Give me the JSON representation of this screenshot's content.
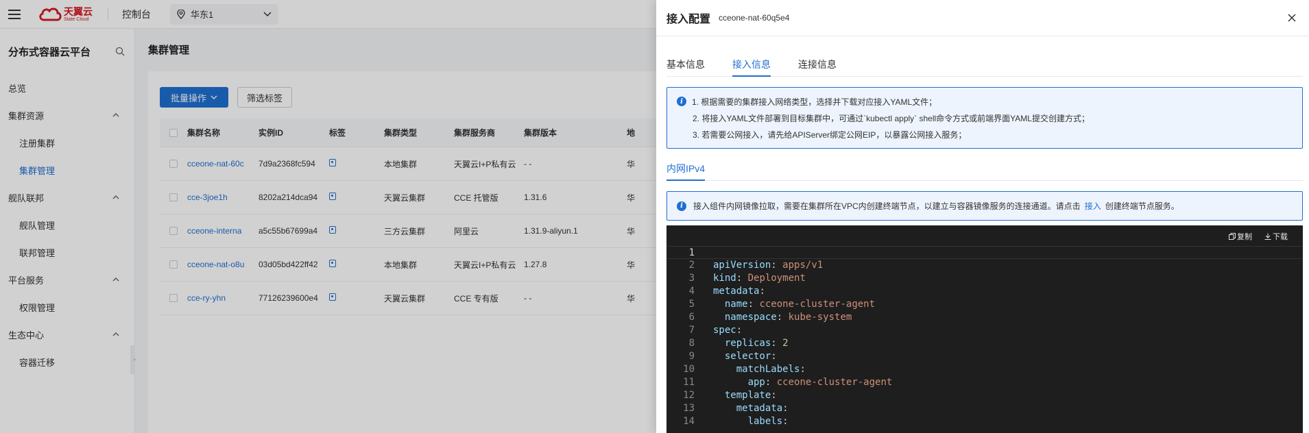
{
  "topbar": {
    "logo_cn": "天翼云",
    "logo_en": "State Cloud",
    "console": "控制台",
    "region": "华东1"
  },
  "sidebar": {
    "title": "分布式容器云平台",
    "items": [
      {
        "label": "总览",
        "type": "item"
      },
      {
        "label": "集群资源",
        "type": "group"
      },
      {
        "label": "注册集群",
        "type": "sub"
      },
      {
        "label": "集群管理",
        "type": "sub",
        "active": true
      },
      {
        "label": "舰队联邦",
        "type": "group"
      },
      {
        "label": "舰队管理",
        "type": "sub"
      },
      {
        "label": "联邦管理",
        "type": "sub"
      },
      {
        "label": "平台服务",
        "type": "group"
      },
      {
        "label": "权限管理",
        "type": "sub"
      },
      {
        "label": "生态中心",
        "type": "group"
      },
      {
        "label": "容器迁移",
        "type": "sub"
      }
    ]
  },
  "main": {
    "title": "集群管理",
    "batch_button": "批量操作",
    "filter_button": "筛选标签",
    "columns": [
      "集群名称",
      "实例ID",
      "标签",
      "集群类型",
      "集群服务商",
      "集群版本",
      "地"
    ],
    "rows": [
      {
        "name": "cceone-nat-60c",
        "id": "7d9a2368fc594",
        "type": "本地集群",
        "provider": "天翼云I+P私有云",
        "version": "- -",
        "region": "华"
      },
      {
        "name": "cce-3joe1h",
        "id": "8202a214dca94",
        "type": "天翼云集群",
        "provider": "CCE 托管版",
        "version": "1.31.6",
        "region": "华"
      },
      {
        "name": "cceone-interna",
        "id": "a5c55b67699a4",
        "type": "三方云集群",
        "provider": "阿里云",
        "version": "1.31.9-aliyun.1",
        "region": "华"
      },
      {
        "name": "cceone-nat-o8u",
        "id": "03d05bd422ff42",
        "type": "本地集群",
        "provider": "天翼云I+P私有云",
        "version": "1.27.8",
        "region": "华"
      },
      {
        "name": "cce-ry-yhn",
        "id": "77126239600e4",
        "type": "天翼云集群",
        "provider": "CCE 专有版",
        "version": "- -",
        "region": "华"
      }
    ]
  },
  "drawer": {
    "title": "接入配置",
    "cluster_id": "cceone-nat-60q5e4",
    "tabs": [
      "基本信息",
      "接入信息",
      "连接信息"
    ],
    "active_tab": 1,
    "notes": [
      "1. 根据需要的集群接入网络类型，选择并下载对应接入YAML文件；",
      "2. 将接入YAML文件部署到目标集群中，可通过`kubectl apply` shell命令方式或前端界面YAML提交创建方式；",
      "3. 若需要公网接入，请先给APIServer绑定公网EIP，以暴露公网接入服务；"
    ],
    "network_tab": "内网IPv4",
    "network_note_pre": "接入组件内网镜像拉取，需要在集群所在VPC内创建终端节点，以建立与容器镜像服务的连接通道。请点击",
    "network_note_link": "接入",
    "network_note_post": "创建终端节点服务。",
    "copy_label": "复制",
    "download_label": "下载",
    "code": [
      {
        "n": "1",
        "key": "",
        "val": "",
        "indent": ""
      },
      {
        "n": "2",
        "key": "apiVersion",
        "val": "apps/v1",
        "indent": ""
      },
      {
        "n": "3",
        "key": "kind",
        "val": "Deployment",
        "indent": ""
      },
      {
        "n": "4",
        "key": "metadata",
        "val": "",
        "indent": ""
      },
      {
        "n": "5",
        "key": "name",
        "val": "cceone-cluster-agent",
        "indent": "  "
      },
      {
        "n": "6",
        "key": "namespace",
        "val": "kube-system",
        "indent": "  "
      },
      {
        "n": "7",
        "key": "spec",
        "val": "",
        "indent": ""
      },
      {
        "n": "8",
        "key": "replicas",
        "val": "2",
        "indent": "  ",
        "num": true
      },
      {
        "n": "9",
        "key": "selector",
        "val": "",
        "indent": "  "
      },
      {
        "n": "10",
        "key": "matchLabels",
        "val": "",
        "indent": "    "
      },
      {
        "n": "11",
        "key": "app",
        "val": "cceone-cluster-agent",
        "indent": "      "
      },
      {
        "n": "12",
        "key": "template",
        "val": "",
        "indent": "  "
      },
      {
        "n": "13",
        "key": "metadata",
        "val": "",
        "indent": "    "
      },
      {
        "n": "14",
        "key": "labels",
        "val": "",
        "indent": "      "
      }
    ]
  },
  "colors": {
    "brand": "#d71920",
    "accent": "#1f6fd1",
    "code_bg": "#1e1e1e"
  }
}
